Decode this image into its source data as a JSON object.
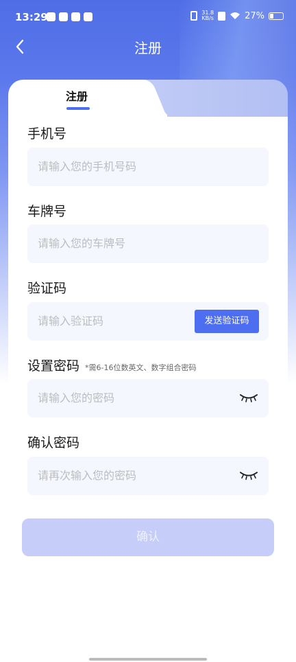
{
  "status_bar": {
    "time": "13:29",
    "net_speed_value": "31.8",
    "net_speed_unit": "KB/s",
    "battery": "27%",
    "battery_level": 0.27,
    "notification_icons": [
      "play-icon",
      "mail-icon",
      "chat-icon",
      "app-icon"
    ]
  },
  "nav": {
    "title": "注册",
    "back_icon": "chevron-left-icon"
  },
  "tabs": [
    {
      "label": "注册",
      "active": true
    }
  ],
  "form": {
    "phone": {
      "label": "手机号",
      "placeholder": "请输入您的手机号码"
    },
    "plate": {
      "label": "车牌号",
      "placeholder": "请输入您的车牌号"
    },
    "code": {
      "label": "验证码",
      "placeholder": "请输入验证码",
      "send_button": "发送验证码"
    },
    "password": {
      "label": "设置密码",
      "hint": "*需6-16位数英文、数字组合密码",
      "placeholder": "请输入您的密码",
      "eye_icon": "eye-closed-icon"
    },
    "password_confirm": {
      "label": "确认密码",
      "placeholder": "请再次输入您的密码",
      "eye_icon": "eye-closed-icon"
    }
  },
  "confirm_button": "确认",
  "colors": {
    "accent": "#4e6ef2",
    "disabled_button": "#c5cdf8",
    "input_bg": "#f5f7ff"
  }
}
